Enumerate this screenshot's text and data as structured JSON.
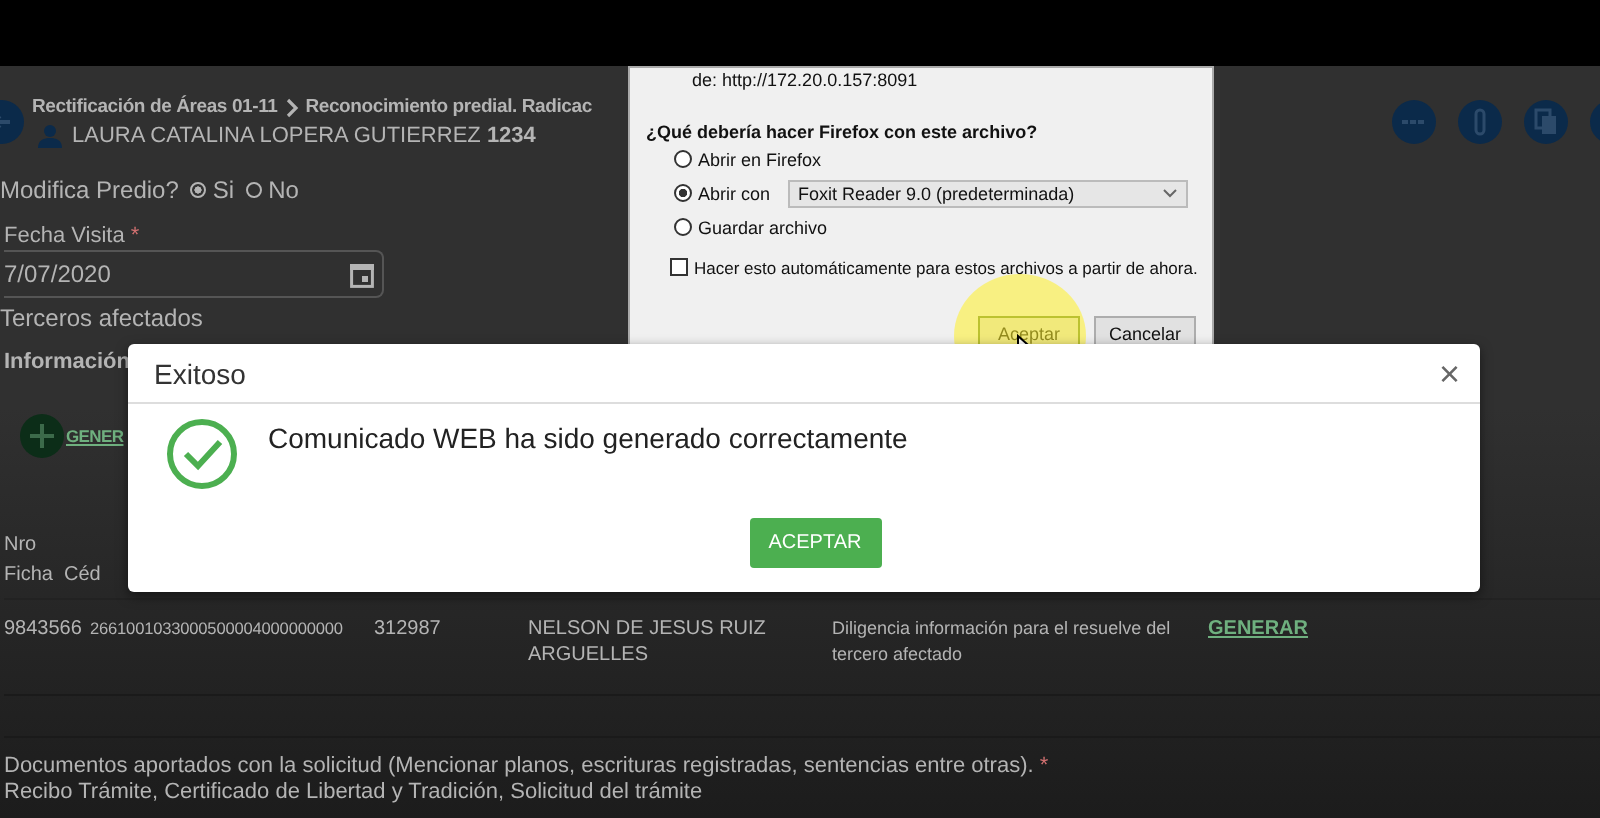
{
  "header": {
    "breadcrumb": [
      "Rectificación de Áreas 01-11",
      "Reconocimiento predial. Radicac"
    ],
    "user_name": "LAURA CATALINA LOPERA GUTIERREZ",
    "user_code": "1234"
  },
  "modifica": {
    "label": "Modifica Predio?",
    "options": [
      {
        "label": "Si",
        "selected": true
      },
      {
        "label": "No",
        "selected": false
      }
    ]
  },
  "fecha": {
    "label": "Fecha Visita",
    "required_mark": "*",
    "value": "7/07/2020"
  },
  "terceros_label": "Terceros afectados",
  "section_title": "Información",
  "add_button": {
    "label": "GENER"
  },
  "table": {
    "columns": [
      "Nro Ficha",
      "Céd"
    ],
    "rows": [
      [
        "9843566",
        "2661001033000500004000000000",
        "312987",
        "NELSON DE JESUS RUIZ ARGUELLES",
        "Diligencia información para el resuelve del tercero afectado",
        "GENERAR"
      ]
    ]
  },
  "documents": {
    "label": "Documentos aportados con la solicitud (Mencionar planos, escrituras registradas, sentencias entre otras).",
    "required_mark": "*",
    "value": "Recibo Trámite, Certificado de Libertad y Tradición, Solicitud del trámite"
  },
  "download_dialog": {
    "source_label": "de:",
    "source": "http://172.20.0.157:8091",
    "question": "¿Qué debería hacer Firefox con este archivo?",
    "options": [
      {
        "label": "Abrir en Firefox",
        "selected": false
      },
      {
        "label": "Abrir con",
        "selected": true
      },
      {
        "label": "Guardar archivo",
        "selected": false
      }
    ],
    "app_select": "Foxit Reader 9.0 (predeterminada)",
    "remember": {
      "label": "Hacer esto automáticamente para estos archivos a partir de ahora.",
      "checked": false
    },
    "buttons": [
      "Aceptar",
      "Cancelar"
    ]
  },
  "modal": {
    "title": "Exitoso",
    "close": "×",
    "message": "Comunicado WEB ha sido generado correctamente",
    "button": "ACEPTAR"
  }
}
